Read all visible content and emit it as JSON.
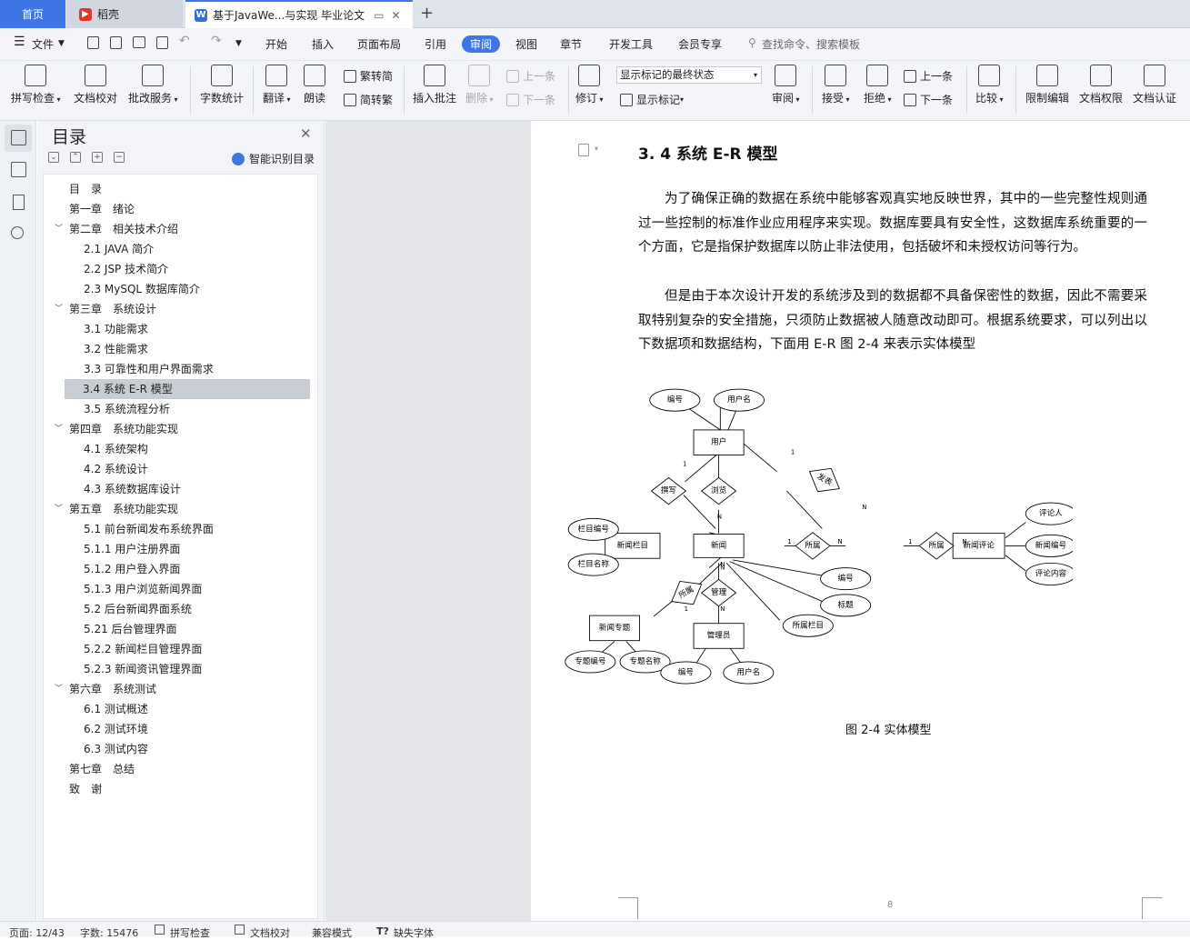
{
  "tabs": {
    "home": "首页",
    "daoke": "稻壳",
    "doc": "基于JavaWe...与实现 毕业论文"
  },
  "menu": {
    "file": "文件",
    "items": [
      "开始",
      "插入",
      "页面布局",
      "引用",
      "审阅",
      "视图",
      "章节",
      "开发工具",
      "会员专享"
    ],
    "search": "查找命令、搜索模板"
  },
  "ribbon": {
    "spell": "拼写检查",
    "proof": "文档校对",
    "batch": "批改服务",
    "wordcount": "字数统计",
    "translate": "翻译",
    "read": "朗读",
    "t2s": "繁转简",
    "s2t": "简转繁",
    "insert_comment": "插入批注",
    "delete": "删除",
    "prev_c": "上一条",
    "next_c": "下一条",
    "revise": "修订",
    "markup_state": "显示标记的最终状态",
    "show_markup": "显示标记",
    "review": "审阅",
    "accept": "接受",
    "reject": "拒绝",
    "prev": "上一条",
    "next": "下一条",
    "compare": "比较",
    "restrict": "限制编辑",
    "permission": "文档权限",
    "certify": "文档认证"
  },
  "toc": {
    "title": "目录",
    "smart": "智能识别目录",
    "items": [
      {
        "text": "目　录",
        "level": 1
      },
      {
        "text": "第一章　绪论",
        "level": 1
      },
      {
        "text": "第二章　相关技术介绍",
        "level": 1,
        "caret": true
      },
      {
        "text": "2.1 JAVA 简介",
        "level": 2
      },
      {
        "text": "2.2 JSP 技术简介",
        "level": 2
      },
      {
        "text": "2.3 MySQL 数据库简介",
        "level": 2
      },
      {
        "text": "第三章　系统设计",
        "level": 1,
        "caret": true
      },
      {
        "text": "3.1 功能需求",
        "level": 2
      },
      {
        "text": "3.2 性能需求",
        "level": 2
      },
      {
        "text": "3.3  可靠性和用户界面需求",
        "level": 2
      },
      {
        "text": "3.4 系统 E-R 模型",
        "level": 2,
        "selected": true
      },
      {
        "text": "3.5  系统流程分析",
        "level": 2
      },
      {
        "text": "第四章　系统功能实现",
        "level": 1,
        "caret": true
      },
      {
        "text": "4.1  系统架构",
        "level": 2
      },
      {
        "text": "4.2  系统设计",
        "level": 2
      },
      {
        "text": "4.3  系统数据库设计",
        "level": 2
      },
      {
        "text": "第五章　系统功能实现",
        "level": 1,
        "caret": true
      },
      {
        "text": "5.1 前台新闻发布系统界面",
        "level": 2
      },
      {
        "text": "5.1.1 用户注册界面",
        "level": 2
      },
      {
        "text": "5.1.2 用户登入界面",
        "level": 2
      },
      {
        "text": "5.1.3 用户浏览新闻界面",
        "level": 2
      },
      {
        "text": "5.2 后台新闻界面系统",
        "level": 2
      },
      {
        "text": "5.21 后台管理界面",
        "level": 2
      },
      {
        "text": "5.2.2 新闻栏目管理界面",
        "level": 2
      },
      {
        "text": "5.2.3 新闻资讯管理界面",
        "level": 2
      },
      {
        "text": "第六章　系统测试",
        "level": 1,
        "caret": true
      },
      {
        "text": "6.1 测试概述",
        "level": 2
      },
      {
        "text": "6.2 测试环境",
        "level": 2
      },
      {
        "text": "6.3 测试内容",
        "level": 2
      },
      {
        "text": "第七章　总结",
        "level": 1
      },
      {
        "text": "致　谢",
        "level": 1
      }
    ]
  },
  "document": {
    "heading": "3. 4 系统 E-R 模型",
    "para1": "为了确保正确的数据在系统中能够客观真实地反映世界，其中的一些完整性规则通过一些控制的标准作业应用程序来实现。数据库要具有安全性，这数据库系统重要的一个方面，它是指保护数据库以防止非法使用，包括破坏和未授权访问等行为。",
    "para2": "但是由于本次设计开发的系统涉及到的数据都不具备保密性的数据，因此不需要采取特别复杂的安全措施，只须防止数据被人随意改动即可。根据系统要求，可以列出以下数据项和数据结构，下面用 E-R 图 2-4 来表示实体模型",
    "caption": "图 2-4 实体模型",
    "page_number": "8"
  },
  "er": {
    "entities": {
      "user": "用户",
      "news": "新闻",
      "column": "新闻栏目",
      "comment": "新闻评论",
      "topic": "新闻专题",
      "admin": "管理员"
    },
    "relations": {
      "write": "撰写",
      "browse": "浏览",
      "publish": "发表",
      "belong1": "所属",
      "belong2": "所属",
      "belong3": "所属",
      "manage": "管理"
    },
    "attrs": {
      "u_id": "编号",
      "u_name": "用户名",
      "col_id": "栏目编号",
      "col_name": "栏目名称",
      "commenter": "评论人",
      "c_news_id": "新闻编号",
      "c_content": "评论内容",
      "n_id": "编号",
      "n_title": "标题",
      "n_col": "所属栏目",
      "t_id": "专题编号",
      "t_name": "专题名称",
      "a_id": "编号",
      "a_name": "用户名"
    },
    "card": {
      "one": "1",
      "n": "N"
    }
  },
  "status": {
    "page": "页面: 12/43",
    "words": "字数: 15476",
    "spell": "拼写检查",
    "proof": "文档校对",
    "compat": "兼容模式",
    "font": "缺失字体"
  }
}
